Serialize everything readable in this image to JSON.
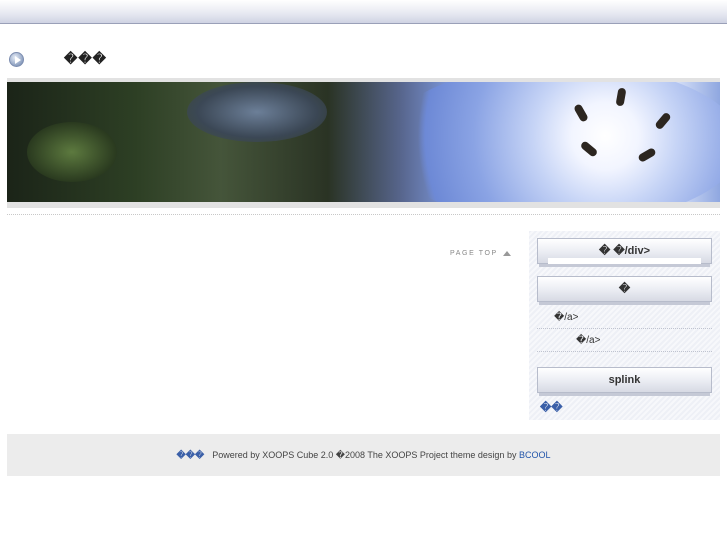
{
  "header": {
    "site_title": "���"
  },
  "banner": {
    "description_icon": "flower-banner-image"
  },
  "main": {
    "page_top_label": "PAGE TOP"
  },
  "sidebar": {
    "block1_title": "�   �/div>",
    "block2_title": "�",
    "links": [
      "�/a>",
      "�/a>"
    ],
    "block3_title": "splink",
    "footer_text": "��"
  },
  "footer": {
    "site": "���",
    "powered_text": "Powered by XOOPS Cube 2.0  �2008 The XOOPS Project theme design by ",
    "link_label": "BCOOL"
  },
  "colors": {
    "topbar": "#cfd3e3",
    "link_blue": "#2255aa",
    "footer_bg": "#ececec"
  }
}
